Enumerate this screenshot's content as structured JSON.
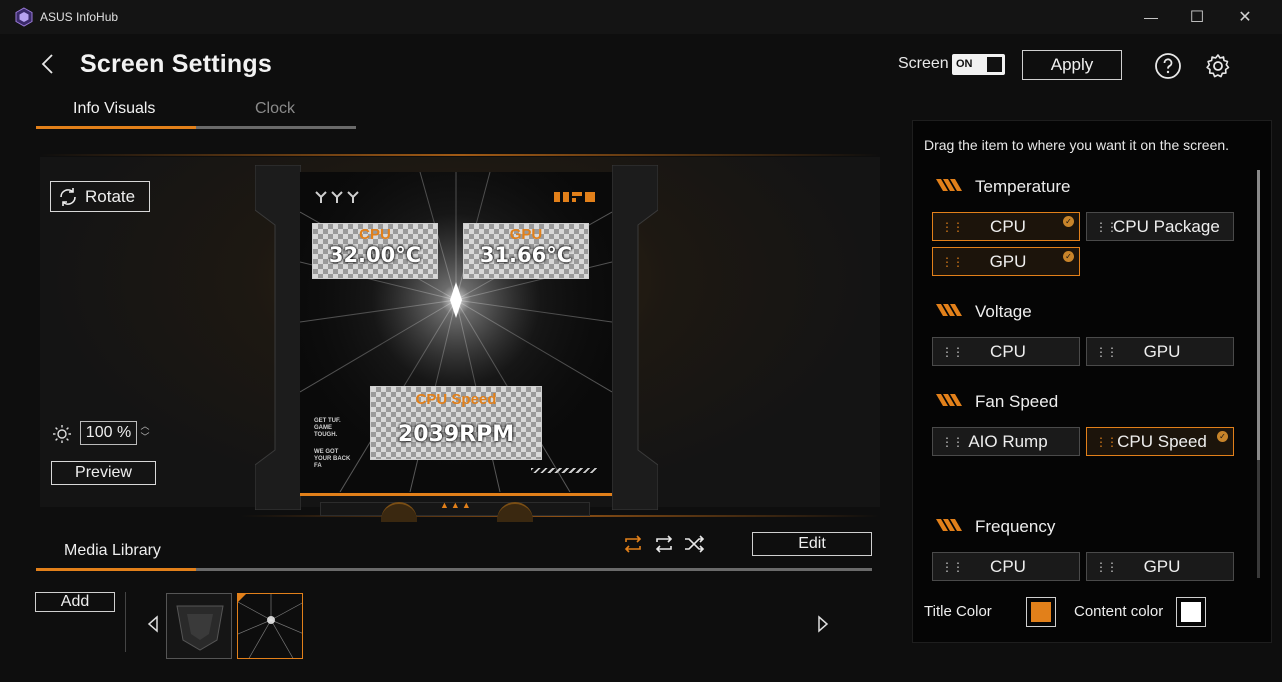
{
  "app": {
    "title": "ASUS InfoHub"
  },
  "window": {
    "minimize": "—",
    "maximize": "☐",
    "close": "✕"
  },
  "header": {
    "title": "Screen Settings",
    "screen_label": "Screen",
    "screen_toggle": "ON",
    "apply": "Apply"
  },
  "tabs": [
    {
      "label": "Info Visuals",
      "active": true
    },
    {
      "label": "Clock",
      "active": false
    }
  ],
  "preview": {
    "rotate": "Rotate",
    "brightness": "100",
    "brightness_unit": "%",
    "preview_btn": "Preview",
    "widgets": [
      {
        "title": "CPU",
        "value": "32.00°C"
      },
      {
        "title": "GPU",
        "value": "31.66°C"
      },
      {
        "title": "CPU Speed",
        "value": "2039RPM"
      }
    ],
    "side_text": [
      "GET TUF.",
      "GAME",
      "TOUGH.",
      "WE GOT",
      "YOUR BACK",
      "FA"
    ]
  },
  "media": {
    "title": "Media Library",
    "edit": "Edit",
    "add": "Add"
  },
  "panel": {
    "hint": "Drag the item to where you want it on the screen.",
    "categories": [
      {
        "title": "Temperature",
        "items": [
          {
            "label": "CPU",
            "selected": true
          },
          {
            "label": "CPU Package",
            "selected": false
          },
          {
            "label": "GPU",
            "selected": true
          }
        ]
      },
      {
        "title": "Voltage",
        "items": [
          {
            "label": "CPU",
            "selected": false
          },
          {
            "label": "GPU",
            "selected": false
          }
        ]
      },
      {
        "title": "Fan Speed",
        "items": [
          {
            "label": "AIO Rump",
            "selected": false
          },
          {
            "label": "CPU Speed",
            "selected": true
          }
        ]
      },
      {
        "title": "Frequency",
        "items": [
          {
            "label": "CPU",
            "selected": false
          },
          {
            "label": "GPU",
            "selected": false
          }
        ]
      }
    ],
    "title_color_label": "Title Color",
    "content_color_label": "Content color",
    "title_color": "#e2801a",
    "content_color": "#ffffff"
  },
  "colors": {
    "accent": "#e2801a",
    "background": "#0e0e0e"
  }
}
